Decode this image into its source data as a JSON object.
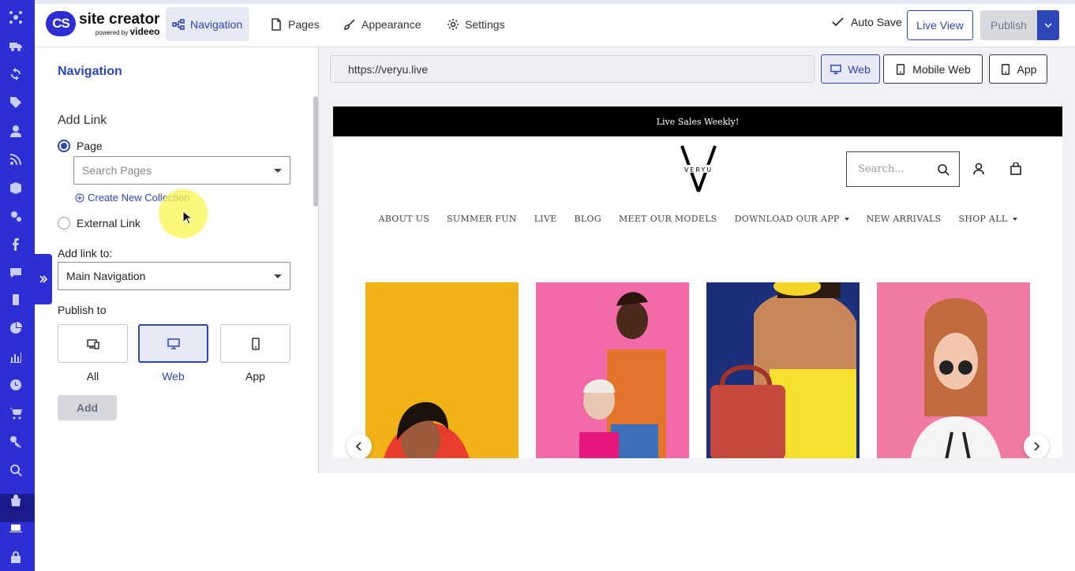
{
  "app": {
    "logo_badge": "CS",
    "logo_name": "site creator",
    "logo_powered": "powered by",
    "logo_brand": "videeo",
    "tabs": [
      {
        "label": "Navigation",
        "icon": "navigation-tree-icon",
        "active": true
      },
      {
        "label": "Pages",
        "icon": "page-icon"
      },
      {
        "label": "Appearance",
        "icon": "paint-brush-icon"
      },
      {
        "label": "Settings",
        "icon": "gear-icon"
      }
    ],
    "auto_save_label": "Auto Save",
    "live_view_label": "Live View",
    "publish_label": "Publish",
    "accent_color": "#2d47b8",
    "rail_color": "#2d2fd4"
  },
  "rail": {
    "icons": [
      "hub-icon",
      "truck-icon",
      "sync-icon",
      "tag-icon",
      "user-icon",
      "rss-icon",
      "box-icon",
      "cogs-icon",
      "facebook-icon",
      "chat-icon",
      "mobile-icon",
      "pie-chart-icon",
      "bar-chart-icon",
      "clock-icon",
      "cart-icon",
      "key-icon",
      "search-icon",
      "shopping-bag-icon",
      "laptop-icon",
      "lock-icon",
      "close-icon"
    ],
    "active": "laptop-icon"
  },
  "panel": {
    "title": "Navigation",
    "add_link_heading": "Add Link",
    "radio_page": "Page",
    "search_pages_placeholder": "Search Pages",
    "create_collection": "Create New Collection",
    "radio_external": "External Link",
    "add_link_to_label": "Add link to:",
    "add_link_to_value": "Main Navigation",
    "publish_to_label": "Publish to",
    "publish_options": [
      {
        "label": "All",
        "icon": "all-devices-icon"
      },
      {
        "label": "Web",
        "icon": "desktop-icon",
        "selected": true
      },
      {
        "label": "App",
        "icon": "mobile-icon"
      }
    ],
    "add_button": "Add"
  },
  "preview": {
    "url": "https://veryu.live",
    "devices": [
      {
        "label": "Web",
        "icon": "desktop-icon",
        "selected": true
      },
      {
        "label": "Mobile Web",
        "icon": "mobile-icon"
      },
      {
        "label": "App",
        "icon": "mobile-icon"
      }
    ]
  },
  "site": {
    "banner": "Live Sales Weekly!",
    "brand_text": "VERYU",
    "search_placeholder": "Search...",
    "menu": [
      {
        "label": "ABOUT US"
      },
      {
        "label": "SUMMER FUN"
      },
      {
        "label": "LIVE"
      },
      {
        "label": "BLOG"
      },
      {
        "label": "MEET OUR MODELS"
      },
      {
        "label": "DOWNLOAD OUR APP",
        "dropdown": true
      },
      {
        "label": "NEW ARRIVALS"
      },
      {
        "label": "SHOP ALL",
        "dropdown": true
      }
    ],
    "product_colors": [
      "#f2b218",
      "#f26aa8",
      "#1c2f7a",
      "#f07aa0"
    ]
  }
}
